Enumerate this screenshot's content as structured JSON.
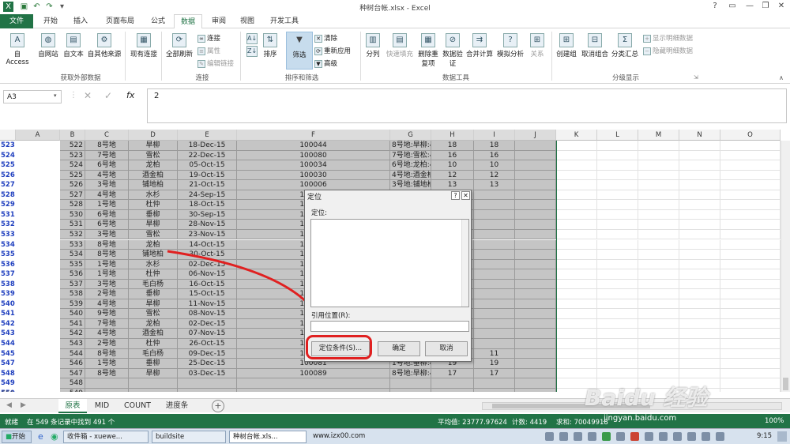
{
  "window": {
    "title": "种树台帐.xlsx - Excel",
    "controls": [
      "?",
      "▭",
      "—",
      "❐",
      "✕"
    ]
  },
  "quick_access": [
    "excel-logo",
    "save",
    "undo",
    "redo",
    "customize"
  ],
  "tabs": [
    "文件",
    "开始",
    "插入",
    "页面布局",
    "公式",
    "数据",
    "审阅",
    "视图",
    "开发工具"
  ],
  "ribbon": {
    "groups": [
      {
        "name": "获取外部数据",
        "buttons": [
          "自 Access",
          "自网站",
          "自文本",
          "自其他来源",
          "现有连接"
        ]
      },
      {
        "name": "连接",
        "buttons": [
          "全部刷新"
        ],
        "small": [
          "连接",
          "属性",
          "编辑链接"
        ]
      },
      {
        "name": "排序和筛选",
        "buttons": [
          "排序",
          "筛选"
        ],
        "small": [
          "清除",
          "重新应用",
          "高级"
        ]
      },
      {
        "name": "数据工具",
        "buttons": [
          "分列",
          "快速填充",
          "删除重复项",
          "数据验证",
          "合并计算",
          "模拟分析",
          "关系"
        ]
      },
      {
        "name": "分级显示",
        "buttons": [
          "创建组",
          "取消组合",
          "分类汇总"
        ],
        "small": [
          "显示明细数据",
          "隐藏明细数据"
        ]
      }
    ]
  },
  "formula_bar": {
    "name_box": "A3",
    "fx": "fx",
    "value": "2"
  },
  "columns": [
    "A",
    "B",
    "C",
    "D",
    "E",
    "F",
    "G",
    "H",
    "I",
    "J",
    "K",
    "L",
    "M",
    "N",
    "O"
  ],
  "rows": [
    {
      "rn": "523",
      "a": "522",
      "b": "8号地",
      "c": "旱柳",
      "d": "18-Dec-15",
      "e": "100044",
      "f": "8号地:旱柳:42356:100044",
      "g": "18",
      "h": "18",
      "i": "100%"
    },
    {
      "rn": "524",
      "a": "523",
      "b": "7号地",
      "c": "雪松",
      "d": "22-Dec-15",
      "e": "100080",
      "f": "7号地:雪松:42359:100080",
      "g": "16",
      "h": "16",
      "i": "100%"
    },
    {
      "rn": "525",
      "a": "524",
      "b": "6号地",
      "c": "龙柏",
      "d": "05-Oct-15",
      "e": "100034",
      "f": "6号地:龙柏:42282:100034",
      "g": "10",
      "h": "10",
      "i": "100%"
    },
    {
      "rn": "526",
      "a": "525",
      "b": "4号地",
      "c": "酒金柏",
      "d": "19-Oct-15",
      "e": "100030",
      "f": "4号地:酒金柏:42296:100030",
      "g": "12",
      "h": "12",
      "i": "100%"
    },
    {
      "rn": "527",
      "a": "526",
      "b": "3号地",
      "c": "铺地柏",
      "d": "21-Oct-15",
      "e": "100006",
      "f": "3号地:铺地柏:42359:100006",
      "g": "13",
      "h": "13",
      "i": "100%"
    },
    {
      "rn": "528",
      "a": "527",
      "b": "4号地",
      "c": "水杉",
      "d": "24-Sep-15",
      "e": "100099",
      "f": "4号地:水杉:4227",
      "g": "",
      "h": "",
      "i": "100%"
    },
    {
      "rn": "529",
      "a": "528",
      "b": "1号地",
      "c": "杜仲",
      "d": "18-Oct-15",
      "e": "100035",
      "f": "1号地:杜仲:4229",
      "g": "",
      "h": "",
      "i": "100%"
    },
    {
      "rn": "531",
      "a": "530",
      "b": "6号地",
      "c": "垂柳",
      "d": "30-Sep-15",
      "e": "100049",
      "f": "6号地:垂柳:4227",
      "g": "",
      "h": "",
      "i": "100%"
    },
    {
      "rn": "532",
      "a": "531",
      "b": "6号地",
      "c": "旱柳",
      "d": "28-Nov-15",
      "e": "100027",
      "f": "6号地:旱柳:4233",
      "g": "",
      "h": "",
      "i": "100%"
    },
    {
      "rn": "533",
      "a": "532",
      "b": "3号地",
      "c": "雪松",
      "d": "23-Nov-15",
      "e": "100005",
      "f": "3号地:雪松:4233",
      "g": "",
      "h": "",
      "i": "100%"
    },
    {
      "rn": "534",
      "a": "533",
      "b": "8号地",
      "c": "龙柏",
      "d": "14-Oct-15",
      "e": "100012",
      "f": "8号地:龙柏:4229",
      "g": "",
      "h": "",
      "i": "100%"
    },
    {
      "rn": "535",
      "a": "534",
      "b": "8号地",
      "c": "铺地柏",
      "d": "30-Oct-15",
      "e": "100079",
      "f": "8号地:铺地柏:4231",
      "g": "",
      "h": "",
      "i": "100%"
    },
    {
      "rn": "536",
      "a": "535",
      "b": "1号地",
      "c": "水杉",
      "d": "02-Dec-15",
      "e": "100072",
      "f": "1号地:水杉:4234",
      "g": "",
      "h": "",
      "i": "100%"
    },
    {
      "rn": "537",
      "a": "536",
      "b": "1号地",
      "c": "杜仲",
      "d": "06-Nov-15",
      "e": "100003",
      "f": "1号地:杜仲:4231",
      "g": "",
      "h": "",
      "i": "100%"
    },
    {
      "rn": "538",
      "a": "537",
      "b": "3号地",
      "c": "毛白杨",
      "d": "16-Oct-15",
      "e": "100037",
      "f": "3号地:毛白杨:42",
      "g": "",
      "h": "",
      "i": "100%"
    },
    {
      "rn": "539",
      "a": "538",
      "b": "2号地",
      "c": "垂柳",
      "d": "15-Oct-15",
      "e": "100096",
      "f": "2号地:垂柳:4229",
      "g": "",
      "h": "",
      "i": "100%"
    },
    {
      "rn": "540",
      "a": "539",
      "b": "4号地",
      "c": "旱柳",
      "d": "11-Nov-15",
      "e": "100039",
      "f": "4号地:旱柳:4231",
      "g": "",
      "h": "",
      "i": "100%"
    },
    {
      "rn": "541",
      "a": "540",
      "b": "9号地",
      "c": "雪松",
      "d": "08-Nov-15",
      "e": "100092",
      "f": "9号地:雪松:4231",
      "g": "",
      "h": "",
      "i": "100%"
    },
    {
      "rn": "542",
      "a": "541",
      "b": "7号地",
      "c": "龙柏",
      "d": "02-Dec-15",
      "e": "100018",
      "f": "7号地:龙柏:4234",
      "g": "",
      "h": "",
      "i": "100%"
    },
    {
      "rn": "543",
      "a": "542",
      "b": "4号地",
      "c": "酒金柏",
      "d": "07-Nov-15",
      "e": "100049",
      "f": "8号地:酒金柏:42",
      "g": "",
      "h": "",
      "i": "100%"
    },
    {
      "rn": "544",
      "a": "543",
      "b": "2号地",
      "c": "杜仲",
      "d": "26-Oct-15",
      "e": "100079",
      "f": "2号地:杜仲:4230",
      "g": "",
      "h": "",
      "i": "100%"
    },
    {
      "rn": "545",
      "a": "544",
      "b": "8号地",
      "c": "毛白杨",
      "d": "09-Dec-15",
      "e": "100058",
      "f": "8号地:毛白杨:42347:100058",
      "g": "11",
      "h": "11",
      "i": "100%"
    },
    {
      "rn": "547",
      "a": "546",
      "b": "1号地",
      "c": "垂柳",
      "d": "25-Dec-15",
      "e": "100081",
      "f": "1号地:垂柳:42363:100081",
      "g": "19",
      "h": "19",
      "i": "100%"
    },
    {
      "rn": "548",
      "a": "547",
      "b": "8号地",
      "c": "旱柳",
      "d": "03-Dec-15",
      "e": "100089",
      "f": "8号地:旱柳:42341:100089",
      "g": "17",
      "h": "17",
      "i": "100%"
    },
    {
      "rn": "549",
      "a": "548",
      "b": "",
      "c": "",
      "d": "",
      "e": "",
      "f": "",
      "g": "",
      "h": "",
      "i": ""
    },
    {
      "rn": "550",
      "a": "549",
      "b": "",
      "c": "",
      "d": "",
      "e": "",
      "f": "",
      "g": "",
      "h": "",
      "i": ""
    }
  ],
  "last_row_number": "551",
  "dialog": {
    "title": "定位",
    "help": "?",
    "close": "✕",
    "goto_label": "定位:",
    "ref_label": "引用位置(R):",
    "ref_value": "",
    "special_button": "定位条件(S)...",
    "ok_button": "确定",
    "cancel_button": "取消"
  },
  "sheet_tabs": [
    "原表",
    "MID",
    "COUNT",
    "进度条"
  ],
  "active_sheet": "原表",
  "status": {
    "mode": "就绪",
    "message": "在 549 条记录中找到 491 个",
    "average": "平均值: 23777.97624",
    "count": "计数: 4419",
    "sum": "求和: 70049918",
    "zoom": "100%"
  },
  "taskbar": {
    "start": "开始",
    "items": [
      "收件箱 - xuewe...",
      "buildsite",
      "种树台帐.xls...",
      "www.izx00.com"
    ],
    "clock": "9:15"
  },
  "watermark": {
    "text": "Baidu 经验",
    "sub": "jingyan.baidu.com"
  },
  "colors": {
    "excel_green": "#217346",
    "highlight_red": "#e02020",
    "selection_gray": "#c5c5c5"
  }
}
